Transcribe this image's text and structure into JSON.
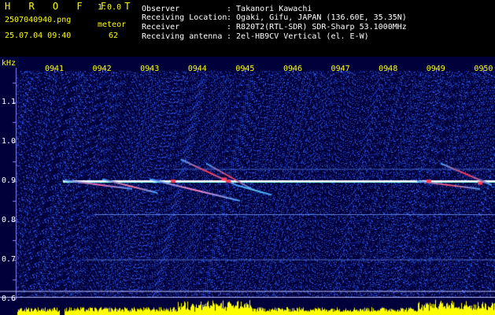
{
  "header": {
    "app_title": "H R O F F T",
    "app_version": "1.0.0",
    "file_name": "2507040940.png",
    "datetime": "25.07.04 09:40",
    "meteor_label": "meteor",
    "meteor_count": "62",
    "info": [
      {
        "label": "Observer",
        "value": ": Takanori Kawachi"
      },
      {
        "label": "Receiving Location",
        "value": ": Ogaki, Gifu, JAPAN (136.60E, 35.35N)"
      },
      {
        "label": "Receiver",
        "value": ": R820T2(RTL-SDR) SDR-Sharp 53.1000MHz"
      },
      {
        "label": "Receiving antenna",
        "value": ": 2el-HB9CV Vertical (el. E-W)"
      }
    ]
  },
  "chart_data": {
    "type": "heatmap",
    "ylabel": "kHz",
    "x_ticks": [
      "0941",
      "0942",
      "0943",
      "0944",
      "0945",
      "0946",
      "0947",
      "0948",
      "0949",
      "0950"
    ],
    "y_ticks": [
      "1.1",
      "1.0",
      "0.9",
      "0.8",
      "0.7",
      "0.6"
    ],
    "xlim": [
      "0940",
      "0950"
    ],
    "ylim": [
      0.58,
      1.19
    ],
    "carrier_khz": 0.9,
    "colors": {
      "background": "#00003a",
      "noise": "#2a3cc8",
      "carrier": "#ffffff",
      "meteor": "#ff4060",
      "histogram": "#ffff00"
    }
  }
}
